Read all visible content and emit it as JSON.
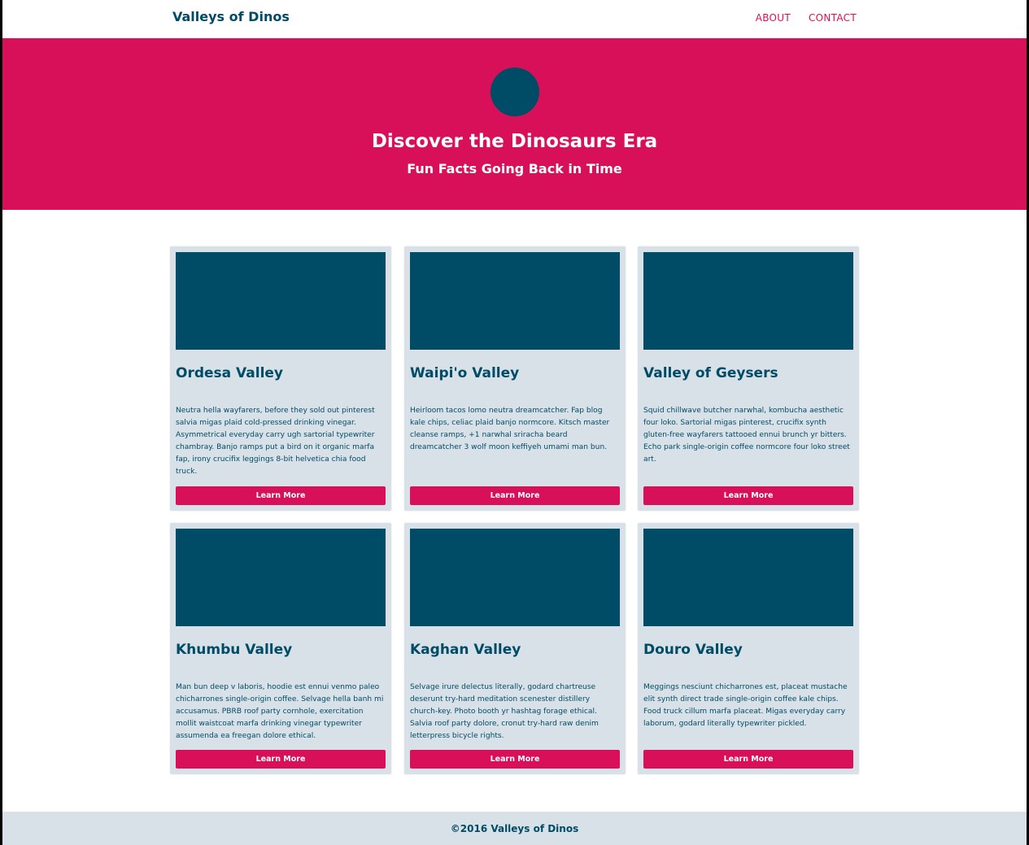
{
  "navbar": {
    "brand": "Valleys of Dinos",
    "links": [
      {
        "label": "ABOUT"
      },
      {
        "label": "CONTACT"
      }
    ]
  },
  "hero": {
    "title": "Discover the Dinosaurs Era",
    "subtitle": "Fun Facts Going Back in Time"
  },
  "cards": [
    {
      "title": "Ordesa Valley",
      "text": "Neutra hella wayfarers, before they sold out pinterest salvia migas plaid cold-pressed drinking vinegar. Asymmetrical everyday carry ugh sartorial typewriter chambray. Banjo ramps put a bird on it organic marfa fap, irony crucifix leggings 8-bit helvetica chia food truck.",
      "button": "Learn More"
    },
    {
      "title": "Waipi'o Valley",
      "text": "Heirloom tacos lomo neutra dreamcatcher. Fap blog kale chips, celiac plaid banjo normcore. Kitsch master cleanse ramps, +1 narwhal sriracha beard dreamcatcher 3 wolf moon keffiyeh umami man bun.",
      "button": "Learn More"
    },
    {
      "title": "Valley of Geysers",
      "text": "Squid chillwave butcher narwhal, kombucha aesthetic four loko. Sartorial migas pinterest, crucifix synth gluten-free wayfarers tattooed ennui brunch yr bitters. Echo park single-origin coffee normcore four loko street art.",
      "button": "Learn More"
    },
    {
      "title": "Khumbu Valley",
      "text": "Man bun deep v laboris, hoodie est ennui venmo paleo chicharrones single-origin coffee. Selvage hella banh mi accusamus. PBRB roof party cornhole, exercitation mollit waistcoat marfa drinking vinegar typewriter assumenda ea freegan dolore ethical.",
      "button": "Learn More"
    },
    {
      "title": "Kaghan Valley",
      "text": "Selvage irure delectus literally, godard chartreuse deserunt try-hard meditation scenester distillery church-key. Photo booth yr hashtag forage ethical. Salvia roof party dolore, cronut try-hard raw denim letterpress bicycle rights.",
      "button": "Learn More"
    },
    {
      "title": "Douro Valley",
      "text": "Meggings nesciunt chicharrones est, placeat mustache elit synth direct trade single-origin coffee kale chips. Food truck cillum marfa placeat. Migas everyday carry laborum, godard literally typewriter pickled.",
      "button": "Learn More"
    }
  ],
  "footer": {
    "text": "©2016 Valleys of Dinos"
  },
  "colors": {
    "primary": "#004c66",
    "accent": "#d81059",
    "card_bg": "#d8e0e8",
    "background": "#ffffff"
  }
}
